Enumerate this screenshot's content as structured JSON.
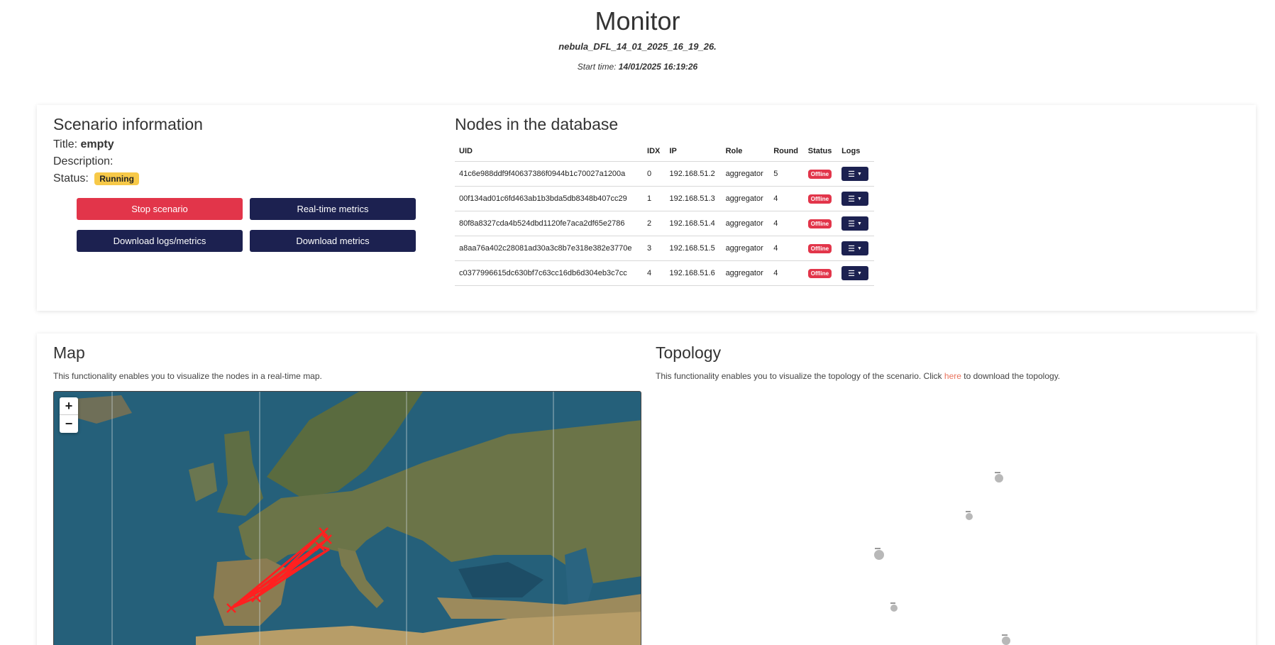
{
  "header": {
    "title": "Monitor",
    "scenario_name": "nebula_DFL_14_01_2025_16_19_26.",
    "start_time_label": "Start time:",
    "start_time_value": "14/01/2025 16:19:26"
  },
  "scenario_info": {
    "heading": "Scenario information",
    "title_label": "Title:",
    "title_value": "empty",
    "description_label": "Description:",
    "status_label": "Status:",
    "status_value": "Running",
    "buttons": {
      "stop": "Stop scenario",
      "realtime": "Real-time metrics",
      "download_logs": "Download logs/metrics",
      "download_metrics": "Download metrics"
    }
  },
  "nodes": {
    "heading": "Nodes in the database",
    "columns": [
      "UID",
      "IDX",
      "IP",
      "Role",
      "Round",
      "Status",
      "Logs"
    ],
    "rows": [
      {
        "uid": "41c6e988ddf9f40637386f0944b1c70027a1200a",
        "idx": "0",
        "ip": "192.168.51.2",
        "role": "aggregator",
        "round": "5",
        "status": "Offline"
      },
      {
        "uid": "00f134ad01c6fd463ab1b3bda5db8348b407cc29",
        "idx": "1",
        "ip": "192.168.51.3",
        "role": "aggregator",
        "round": "4",
        "status": "Offline"
      },
      {
        "uid": "80f8a8327cda4b524dbd1120fe7aca2df65e2786",
        "idx": "2",
        "ip": "192.168.51.4",
        "role": "aggregator",
        "round": "4",
        "status": "Offline"
      },
      {
        "uid": "a8aa76a402c28081ad30a3c8b7e318e382e3770e",
        "idx": "3",
        "ip": "192.168.51.5",
        "role": "aggregator",
        "round": "4",
        "status": "Offline"
      },
      {
        "uid": "c0377996615dc630bf7c63cc16db6d304eb3c7cc",
        "idx": "4",
        "ip": "192.168.51.6",
        "role": "aggregator",
        "round": "4",
        "status": "Offline"
      }
    ]
  },
  "map_section": {
    "heading": "Map",
    "description": "This functionality enables you to visualize the nodes in a real-time map.",
    "zoom_in": "+",
    "zoom_out": "−"
  },
  "topology_section": {
    "heading": "Topology",
    "description_before": "This functionality enables you to visualize the topology of the scenario. Click ",
    "link": "here",
    "description_after": " to download the topology."
  },
  "colors": {
    "accent_red": "#e2354a",
    "navy": "#1c2150",
    "badge_yellow": "#f7c948",
    "link": "#e8725c"
  }
}
